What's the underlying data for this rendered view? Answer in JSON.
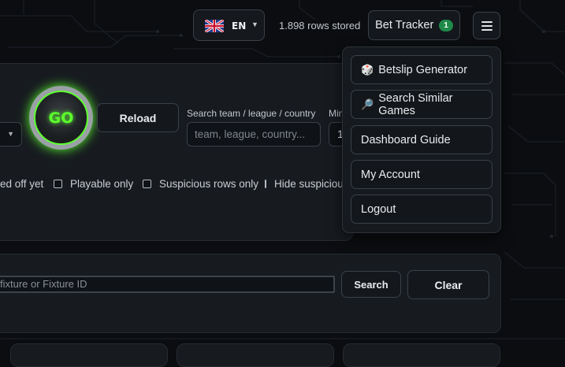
{
  "header": {
    "language": {
      "code": "EN",
      "flag": "uk-flag-icon"
    },
    "rows_stored": "1.898 rows stored",
    "bet_tracker": {
      "label": "Bet Tracker",
      "count": "1"
    },
    "menu_icon": "hamburger-icon"
  },
  "controls": {
    "go_label": "GO",
    "reload_label": "Reload",
    "search_label": "Search team / league / country",
    "search_placeholder": "team, league, country...",
    "min_label": "Min",
    "min_value": "1"
  },
  "filters": [
    {
      "label": "ed off yet",
      "checked": false
    },
    {
      "label": "Playable only",
      "checked": false
    },
    {
      "label": "Suspicious rows only",
      "checked": false
    },
    {
      "label": "Hide suspicious",
      "checked": false
    }
  ],
  "fixture_search": {
    "placeholder": "fixture or Fixture ID",
    "search_label": "Search",
    "clear_label": "Clear"
  },
  "menu": {
    "items": [
      {
        "label": "Betslip Generator",
        "icon": "dice-icon",
        "glyph": "🎲"
      },
      {
        "label": "Search Similar Games",
        "icon": "magnifier-icon",
        "glyph": "🔎"
      },
      {
        "label": "Dashboard Guide"
      },
      {
        "label": "My Account"
      },
      {
        "label": "Logout"
      }
    ]
  },
  "colors": {
    "background": "#0b0d10",
    "panel": "#171b20",
    "accent_green": "#5cff2e",
    "badge_green": "#1f8a49"
  }
}
